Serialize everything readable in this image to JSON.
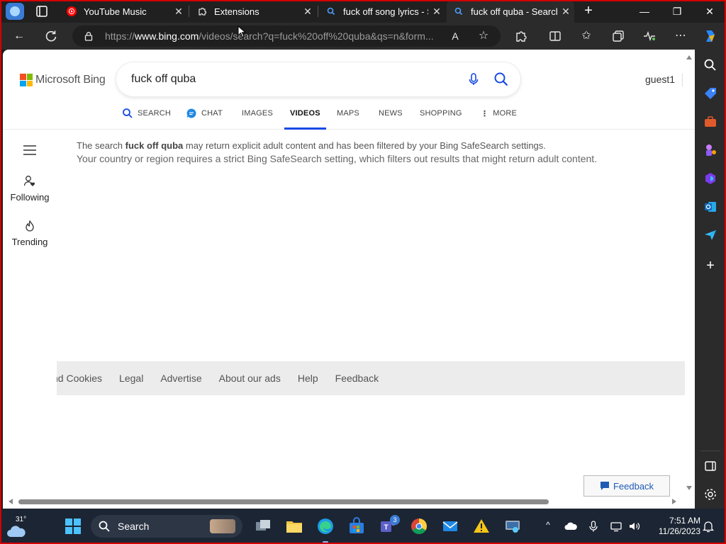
{
  "browser": {
    "tabs": [
      {
        "title": "YouTube Music",
        "favicon": "youtube-music-icon",
        "active": false
      },
      {
        "title": "Extensions",
        "favicon": "extensions-icon",
        "active": false
      },
      {
        "title": "fuck off song lyrics - S",
        "favicon": "bing-search-icon",
        "active": false
      },
      {
        "title": "fuck off quba - Search",
        "favicon": "bing-search-icon",
        "active": true
      }
    ],
    "url_prefix": "https://",
    "url_domain": "www.bing.com",
    "url_rest": "/videos/search?q=fuck%20off%20quba&qs=n&form..."
  },
  "bing": {
    "brand": "Microsoft Bing",
    "query": "fuck off quba",
    "user": "guest1",
    "scopes": [
      {
        "label": "SEARCH",
        "active": false
      },
      {
        "label": "CHAT",
        "active": false
      },
      {
        "label": "IMAGES",
        "active": false
      },
      {
        "label": "VIDEOS",
        "active": true
      },
      {
        "label": "MAPS",
        "active": false
      },
      {
        "label": "NEWS",
        "active": false
      },
      {
        "label": "SHOPPING",
        "active": false
      },
      {
        "label": "MORE",
        "active": false
      }
    ],
    "side_nav": {
      "following": "Following",
      "trending": "Trending"
    },
    "notice": {
      "prefix": "The search ",
      "term": "fuck off quba",
      "suffix": " may return explicit adult content and has been filtered by your Bing SafeSearch settings.",
      "line2": "Your country or region requires a strict Bing SafeSearch setting, which filters out results that might return adult content."
    },
    "footer_links": [
      "nd Cookies",
      "Legal",
      "Advertise",
      "About our ads",
      "Help",
      "Feedback"
    ],
    "feedback_button": "Feedback"
  },
  "taskbar": {
    "temperature": "31°",
    "search_label": "Search",
    "teams_badge": "3",
    "time": "7:51 AM",
    "date": "11/26/2023"
  },
  "colors": {
    "accent_blue": "#174ae4",
    "ms_red": "#f25022",
    "ms_green": "#7fba00",
    "ms_blue": "#00a4ef",
    "ms_yellow": "#ffb900"
  }
}
